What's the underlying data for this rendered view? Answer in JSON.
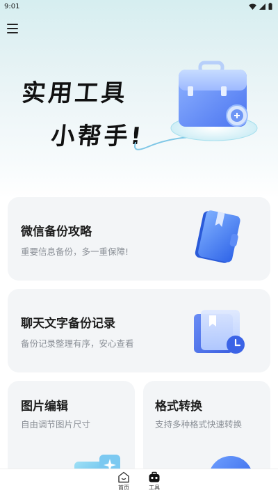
{
  "status_bar": {
    "time": "9:01"
  },
  "hero": {
    "title_line1": "实用工具",
    "title_line2": "小帮手!"
  },
  "cards": [
    {
      "title": "微信备份攻略",
      "subtitle": "重要信息备份，多一重保障!"
    },
    {
      "title": "聊天文字备份记录",
      "subtitle": "备份记录整理有序，安心查看"
    },
    {
      "title": "图片编辑",
      "subtitle": "自由调节图片尺寸"
    },
    {
      "title": "格式转换",
      "subtitle": "支持多种格式快速转换"
    }
  ],
  "bottom_nav": [
    {
      "label": "首页",
      "icon": "home-icon"
    },
    {
      "label": "工具",
      "icon": "toolbox-icon"
    }
  ],
  "colors": {
    "accent_blue": "#3b7bff",
    "card_bg": "#f3f5f7",
    "text_primary": "#1e1e1e",
    "text_secondary": "#8a8f96"
  }
}
